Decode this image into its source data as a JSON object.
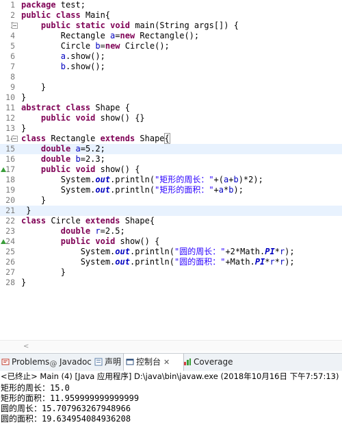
{
  "editor": {
    "highlighted_lines": [
      15,
      21
    ],
    "fold_lines": [
      3,
      14
    ],
    "override_lines": [
      17,
      24
    ],
    "lines": [
      {
        "n": "1",
        "tokens": [
          {
            "t": "kw",
            "v": "package"
          },
          {
            "t": "p",
            "v": " test;"
          }
        ]
      },
      {
        "n": "2",
        "tokens": [
          {
            "t": "kw",
            "v": "public"
          },
          {
            "t": "p",
            "v": " "
          },
          {
            "t": "kw",
            "v": "class"
          },
          {
            "t": "p",
            "v": " Main{"
          }
        ]
      },
      {
        "n": "3",
        "tokens": [
          {
            "t": "p",
            "v": "    "
          },
          {
            "t": "kw",
            "v": "public"
          },
          {
            "t": "p",
            "v": " "
          },
          {
            "t": "kw",
            "v": "static"
          },
          {
            "t": "p",
            "v": " "
          },
          {
            "t": "kw",
            "v": "void"
          },
          {
            "t": "p",
            "v": " main(String args[]) {"
          }
        ]
      },
      {
        "n": "4",
        "tokens": [
          {
            "t": "p",
            "v": "        Rectangle "
          },
          {
            "t": "f",
            "v": "a"
          },
          {
            "t": "p",
            "v": "="
          },
          {
            "t": "kw",
            "v": "new"
          },
          {
            "t": "p",
            "v": " Rectangle();"
          }
        ]
      },
      {
        "n": "5",
        "tokens": [
          {
            "t": "p",
            "v": "        Circle "
          },
          {
            "t": "f",
            "v": "b"
          },
          {
            "t": "p",
            "v": "="
          },
          {
            "t": "kw",
            "v": "new"
          },
          {
            "t": "p",
            "v": " Circle();"
          }
        ]
      },
      {
        "n": "6",
        "tokens": [
          {
            "t": "p",
            "v": "        "
          },
          {
            "t": "f",
            "v": "a"
          },
          {
            "t": "p",
            "v": ".show();"
          }
        ]
      },
      {
        "n": "7",
        "tokens": [
          {
            "t": "p",
            "v": "        "
          },
          {
            "t": "f",
            "v": "b"
          },
          {
            "t": "p",
            "v": ".show();"
          }
        ]
      },
      {
        "n": "8",
        "tokens": []
      },
      {
        "n": "9",
        "tokens": [
          {
            "t": "p",
            "v": "    }"
          }
        ]
      },
      {
        "n": "10",
        "tokens": [
          {
            "t": "p",
            "v": "}"
          }
        ]
      },
      {
        "n": "11",
        "tokens": [
          {
            "t": "kw",
            "v": "abstract"
          },
          {
            "t": "p",
            "v": " "
          },
          {
            "t": "kw",
            "v": "class"
          },
          {
            "t": "p",
            "v": " Shape {"
          }
        ]
      },
      {
        "n": "12",
        "tokens": [
          {
            "t": "p",
            "v": "    "
          },
          {
            "t": "kw",
            "v": "public"
          },
          {
            "t": "p",
            "v": " "
          },
          {
            "t": "kw",
            "v": "void"
          },
          {
            "t": "p",
            "v": " show() {}"
          }
        ]
      },
      {
        "n": "13",
        "tokens": [
          {
            "t": "p",
            "v": "}"
          }
        ]
      },
      {
        "n": "14",
        "tokens": [
          {
            "t": "kw",
            "v": "class"
          },
          {
            "t": "p",
            "v": " Rectangle "
          },
          {
            "t": "kw",
            "v": "extends"
          },
          {
            "t": "p",
            "v": " Shape"
          },
          {
            "t": "b",
            "v": "{"
          }
        ]
      },
      {
        "n": "15",
        "tokens": [
          {
            "t": "p",
            "v": "    "
          },
          {
            "t": "kw",
            "v": "double"
          },
          {
            "t": "p",
            "v": " "
          },
          {
            "t": "f",
            "v": "a"
          },
          {
            "t": "p",
            "v": "=5.2;"
          }
        ]
      },
      {
        "n": "16",
        "tokens": [
          {
            "t": "p",
            "v": "    "
          },
          {
            "t": "kw",
            "v": "double"
          },
          {
            "t": "p",
            "v": " "
          },
          {
            "t": "f",
            "v": "b"
          },
          {
            "t": "p",
            "v": "=2.3;"
          }
        ]
      },
      {
        "n": "17",
        "tokens": [
          {
            "t": "p",
            "v": "    "
          },
          {
            "t": "kw",
            "v": "public"
          },
          {
            "t": "p",
            "v": " "
          },
          {
            "t": "kw",
            "v": "void"
          },
          {
            "t": "p",
            "v": " show() {"
          }
        ]
      },
      {
        "n": "18",
        "tokens": [
          {
            "t": "p",
            "v": "        System."
          },
          {
            "t": "s",
            "v": "out"
          },
          {
            "t": "p",
            "v": ".println("
          },
          {
            "t": "str",
            "v": "\"矩形的周长：\""
          },
          {
            "t": "p",
            "v": "+("
          },
          {
            "t": "f",
            "v": "a"
          },
          {
            "t": "p",
            "v": "+"
          },
          {
            "t": "f",
            "v": "b"
          },
          {
            "t": "p",
            "v": ")*2);"
          }
        ]
      },
      {
        "n": "19",
        "tokens": [
          {
            "t": "p",
            "v": "        System."
          },
          {
            "t": "s",
            "v": "out"
          },
          {
            "t": "p",
            "v": ".println("
          },
          {
            "t": "str",
            "v": "\"矩形的面积：\""
          },
          {
            "t": "p",
            "v": "+"
          },
          {
            "t": "f",
            "v": "a"
          },
          {
            "t": "p",
            "v": "*"
          },
          {
            "t": "f",
            "v": "b"
          },
          {
            "t": "p",
            "v": ");"
          }
        ]
      },
      {
        "n": "20",
        "tokens": [
          {
            "t": "p",
            "v": "    }"
          }
        ]
      },
      {
        "n": "21",
        "tokens": [
          {
            "t": "p",
            "v": " }"
          }
        ]
      },
      {
        "n": "22",
        "tokens": [
          {
            "t": "kw",
            "v": "class"
          },
          {
            "t": "p",
            "v": " Circle "
          },
          {
            "t": "kw",
            "v": "extends"
          },
          {
            "t": "p",
            "v": " Shape{"
          }
        ]
      },
      {
        "n": "23",
        "tokens": [
          {
            "t": "p",
            "v": "        "
          },
          {
            "t": "kw",
            "v": "double"
          },
          {
            "t": "p",
            "v": " "
          },
          {
            "t": "f",
            "v": "r"
          },
          {
            "t": "p",
            "v": "=2.5;"
          }
        ]
      },
      {
        "n": "24",
        "tokens": [
          {
            "t": "p",
            "v": "        "
          },
          {
            "t": "kw",
            "v": "public"
          },
          {
            "t": "p",
            "v": " "
          },
          {
            "t": "kw",
            "v": "void"
          },
          {
            "t": "p",
            "v": " show() {"
          }
        ]
      },
      {
        "n": "25",
        "tokens": [
          {
            "t": "p",
            "v": "            System."
          },
          {
            "t": "s",
            "v": "out"
          },
          {
            "t": "p",
            "v": ".println("
          },
          {
            "t": "str",
            "v": "\"圆的周长：\""
          },
          {
            "t": "p",
            "v": "+2*Math."
          },
          {
            "t": "s",
            "v": "PI"
          },
          {
            "t": "p",
            "v": "*"
          },
          {
            "t": "f",
            "v": "r"
          },
          {
            "t": "p",
            "v": ");"
          }
        ]
      },
      {
        "n": "26",
        "tokens": [
          {
            "t": "p",
            "v": "            System."
          },
          {
            "t": "s",
            "v": "out"
          },
          {
            "t": "p",
            "v": ".println("
          },
          {
            "t": "str",
            "v": "\"圆的面积：\""
          },
          {
            "t": "p",
            "v": "+Math."
          },
          {
            "t": "s",
            "v": "PI"
          },
          {
            "t": "p",
            "v": "*"
          },
          {
            "t": "f",
            "v": "r"
          },
          {
            "t": "p",
            "v": "*"
          },
          {
            "t": "f",
            "v": "r"
          },
          {
            "t": "p",
            "v": ");"
          }
        ]
      },
      {
        "n": "27",
        "tokens": [
          {
            "t": "p",
            "v": "        }"
          }
        ]
      },
      {
        "n": "28",
        "tokens": [
          {
            "t": "p",
            "v": "}"
          }
        ]
      }
    ]
  },
  "tabs": [
    {
      "label": "Problems",
      "icon": "problems-icon",
      "active": false
    },
    {
      "label": "Javadoc",
      "icon": "javadoc-icon",
      "active": false
    },
    {
      "label": "声明",
      "icon": "declaration-icon",
      "active": false
    },
    {
      "label": "控制台",
      "icon": "console-icon",
      "active": true,
      "close": "✕"
    },
    {
      "label": "Coverage",
      "icon": "coverage-icon",
      "active": false
    }
  ],
  "console": {
    "header": "<已终止> Main (4)  [Java 应用程序] D:\\java\\bin\\javaw.exe  (2018年10月16日 下午7:57:13)",
    "lines": [
      "矩形的周长：15.0",
      "矩形的面积：11.959999999999999",
      "圆的周长：15.707963267948966",
      "圆的面积：19.634954084936208"
    ]
  },
  "scroll": {
    "left_arrow": "<"
  }
}
